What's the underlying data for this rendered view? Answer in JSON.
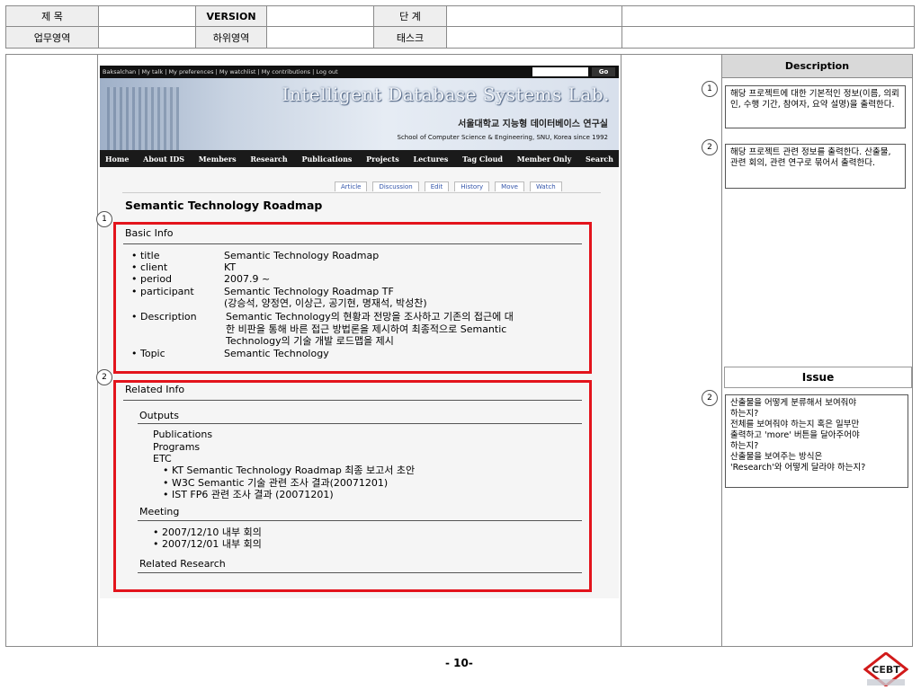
{
  "header_table": {
    "row1": {
      "title_label": "제 목",
      "version_label": "VERSION",
      "stage_label": "단 계"
    },
    "row2": {
      "area_label": "업무영역",
      "subarea_label": "하위영역",
      "task_label": "태스크"
    }
  },
  "site": {
    "top_links": "Baksalchan  |  My talk  |  My preferences  |  My watchlist  |  My contributions  |  Log out",
    "go_label": "Go",
    "lab_title": "Intelligent Database Systems Lab.",
    "lab_kor": "서울대학교 지능형 데이터베이스 연구실",
    "lab_school": "School of Computer Science & Engineering, SNU, Korea since 1992",
    "nav": [
      "Home",
      "About IDS",
      "Members",
      "Research",
      "Publications",
      "Projects",
      "Lectures",
      "Tag Cloud",
      "Member Only",
      "Search"
    ],
    "tabs": [
      "Article",
      "Discussion",
      "Edit",
      "History",
      "Move",
      "Watch"
    ]
  },
  "page": {
    "title": "Semantic Technology Roadmap",
    "basic_info": {
      "heading": "Basic Info",
      "rows": [
        {
          "key": "• title",
          "val": "Semantic Technology Roadmap"
        },
        {
          "key": "• client",
          "val": "KT"
        },
        {
          "key": "• period",
          "val": "2007.9 ~"
        },
        {
          "key": "• participant",
          "val": "Semantic Technology Roadmap TF"
        }
      ],
      "participant_names": "(강승석, 양정연, 이상근, 공기현, 명재석, 박성찬)",
      "description_key": "• Description",
      "description_lines": [
        "Semantic Technology의 현황과 전망을 조사하고 기존의 접근에 대",
        "한 비판을 통해 바른 접근 방법론을 제시하여 최종적으로 Semantic",
        "Technology의 기술 개발 로드맵을 제시"
      ],
      "topic_key": "• Topic",
      "topic_val": "Semantic Technology"
    },
    "related_info": {
      "heading": "Related Info",
      "outputs_heading": "Outputs",
      "outputs": [
        "Publications",
        "Programs",
        "ETC"
      ],
      "etc_items": [
        "• KT Semantic Technology Roadmap 최종 보고서 초안",
        "• W3C Semantic 기술 관련 조사 결과(20071201)",
        "• IST FP6 관련 조사 결과 (20071201)"
      ],
      "meeting_heading": "Meeting",
      "meetings": [
        "• 2007/12/10 내부 회의",
        "• 2007/12/01 내부 회의"
      ],
      "related_research_heading": "Related Research"
    }
  },
  "markers": {
    "one": "1",
    "two": "2"
  },
  "description_panel": {
    "heading": "Description",
    "note1": "해당 프로젝트에 대한 기본적인 정보(이름, 의뢰인, 수행 기간, 참여자, 요약 설명)을 출력한다.",
    "note2": "해당 프로젝트 관련 정보를 출력한다. 산출물, 관련 회의, 관련 연구로 묶어서 출력한다."
  },
  "issue_panel": {
    "heading": "Issue",
    "lines": [
      "산출물을 어떻게 분류해서 보여줘야",
      "하는지?",
      "전체를 보여줘야 하는지 혹은 일부만",
      "출력하고 'more' 버튼을 달아주어야",
      "하는지?",
      "산출물을 보여주는 방식은",
      "'Research'와 어떻게 달라야 하는지?"
    ]
  },
  "footer": {
    "page_number": "- 10-",
    "logo_text": "CEBT"
  },
  "colors": {
    "highlight": "#e3141c",
    "nav_bg": "#1a1a1a"
  }
}
